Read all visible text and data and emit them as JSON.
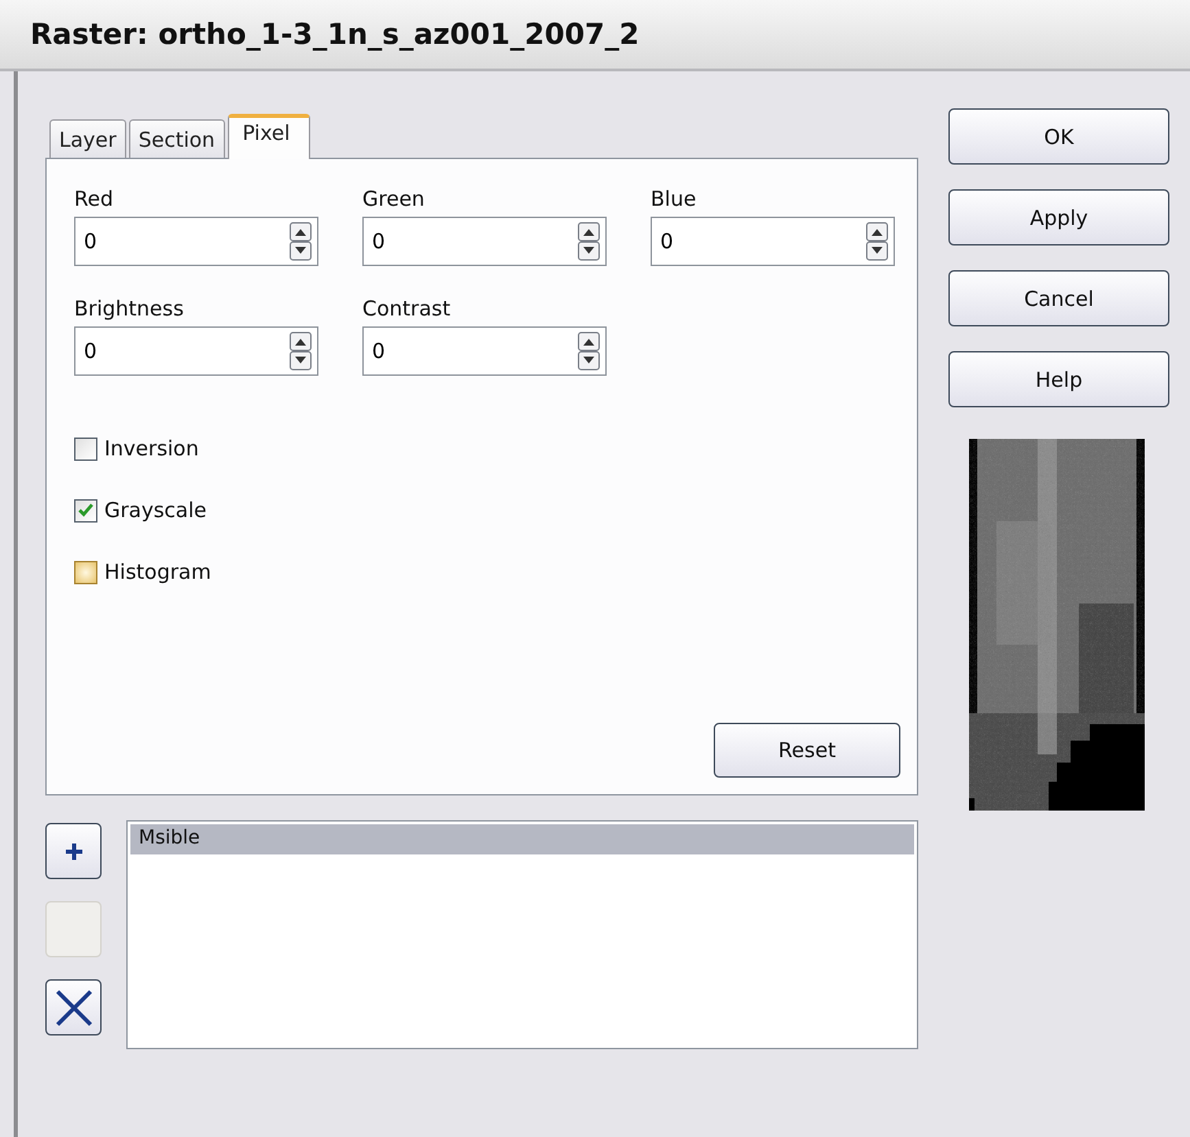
{
  "window": {
    "title": "Raster: ortho_1-3_1n_s_az001_2007_2"
  },
  "tabs": [
    {
      "label": "Layer",
      "selected": false
    },
    {
      "label": "Section",
      "selected": false
    },
    {
      "label": "Pixel",
      "selected": true
    }
  ],
  "fields": [
    {
      "label": "Red",
      "value": "0"
    },
    {
      "label": "Green",
      "value": "0"
    },
    {
      "label": "Blue",
      "value": "0"
    },
    {
      "label": "Brightness",
      "value": "0"
    },
    {
      "label": "Contrast",
      "value": "0"
    }
  ],
  "checkboxes": [
    {
      "label": "Inversion",
      "checked": false,
      "highlighted": false
    },
    {
      "label": "Grayscale",
      "checked": true,
      "highlighted": false
    },
    {
      "label": "Histogram",
      "checked": false,
      "highlighted": true
    }
  ],
  "reset_button": {
    "label": "Reset"
  },
  "list_buttons": [
    {
      "kind": "add",
      "disabled": false
    },
    {
      "kind": "blank",
      "disabled": true
    },
    {
      "kind": "delete",
      "disabled": false
    }
  ],
  "list": {
    "rows": [
      {
        "label": "Msible",
        "selected": true
      }
    ]
  },
  "buttons": [
    "OK",
    "Apply",
    "Cancel",
    "Help"
  ],
  "preview": {
    "kind": "picture"
  }
}
